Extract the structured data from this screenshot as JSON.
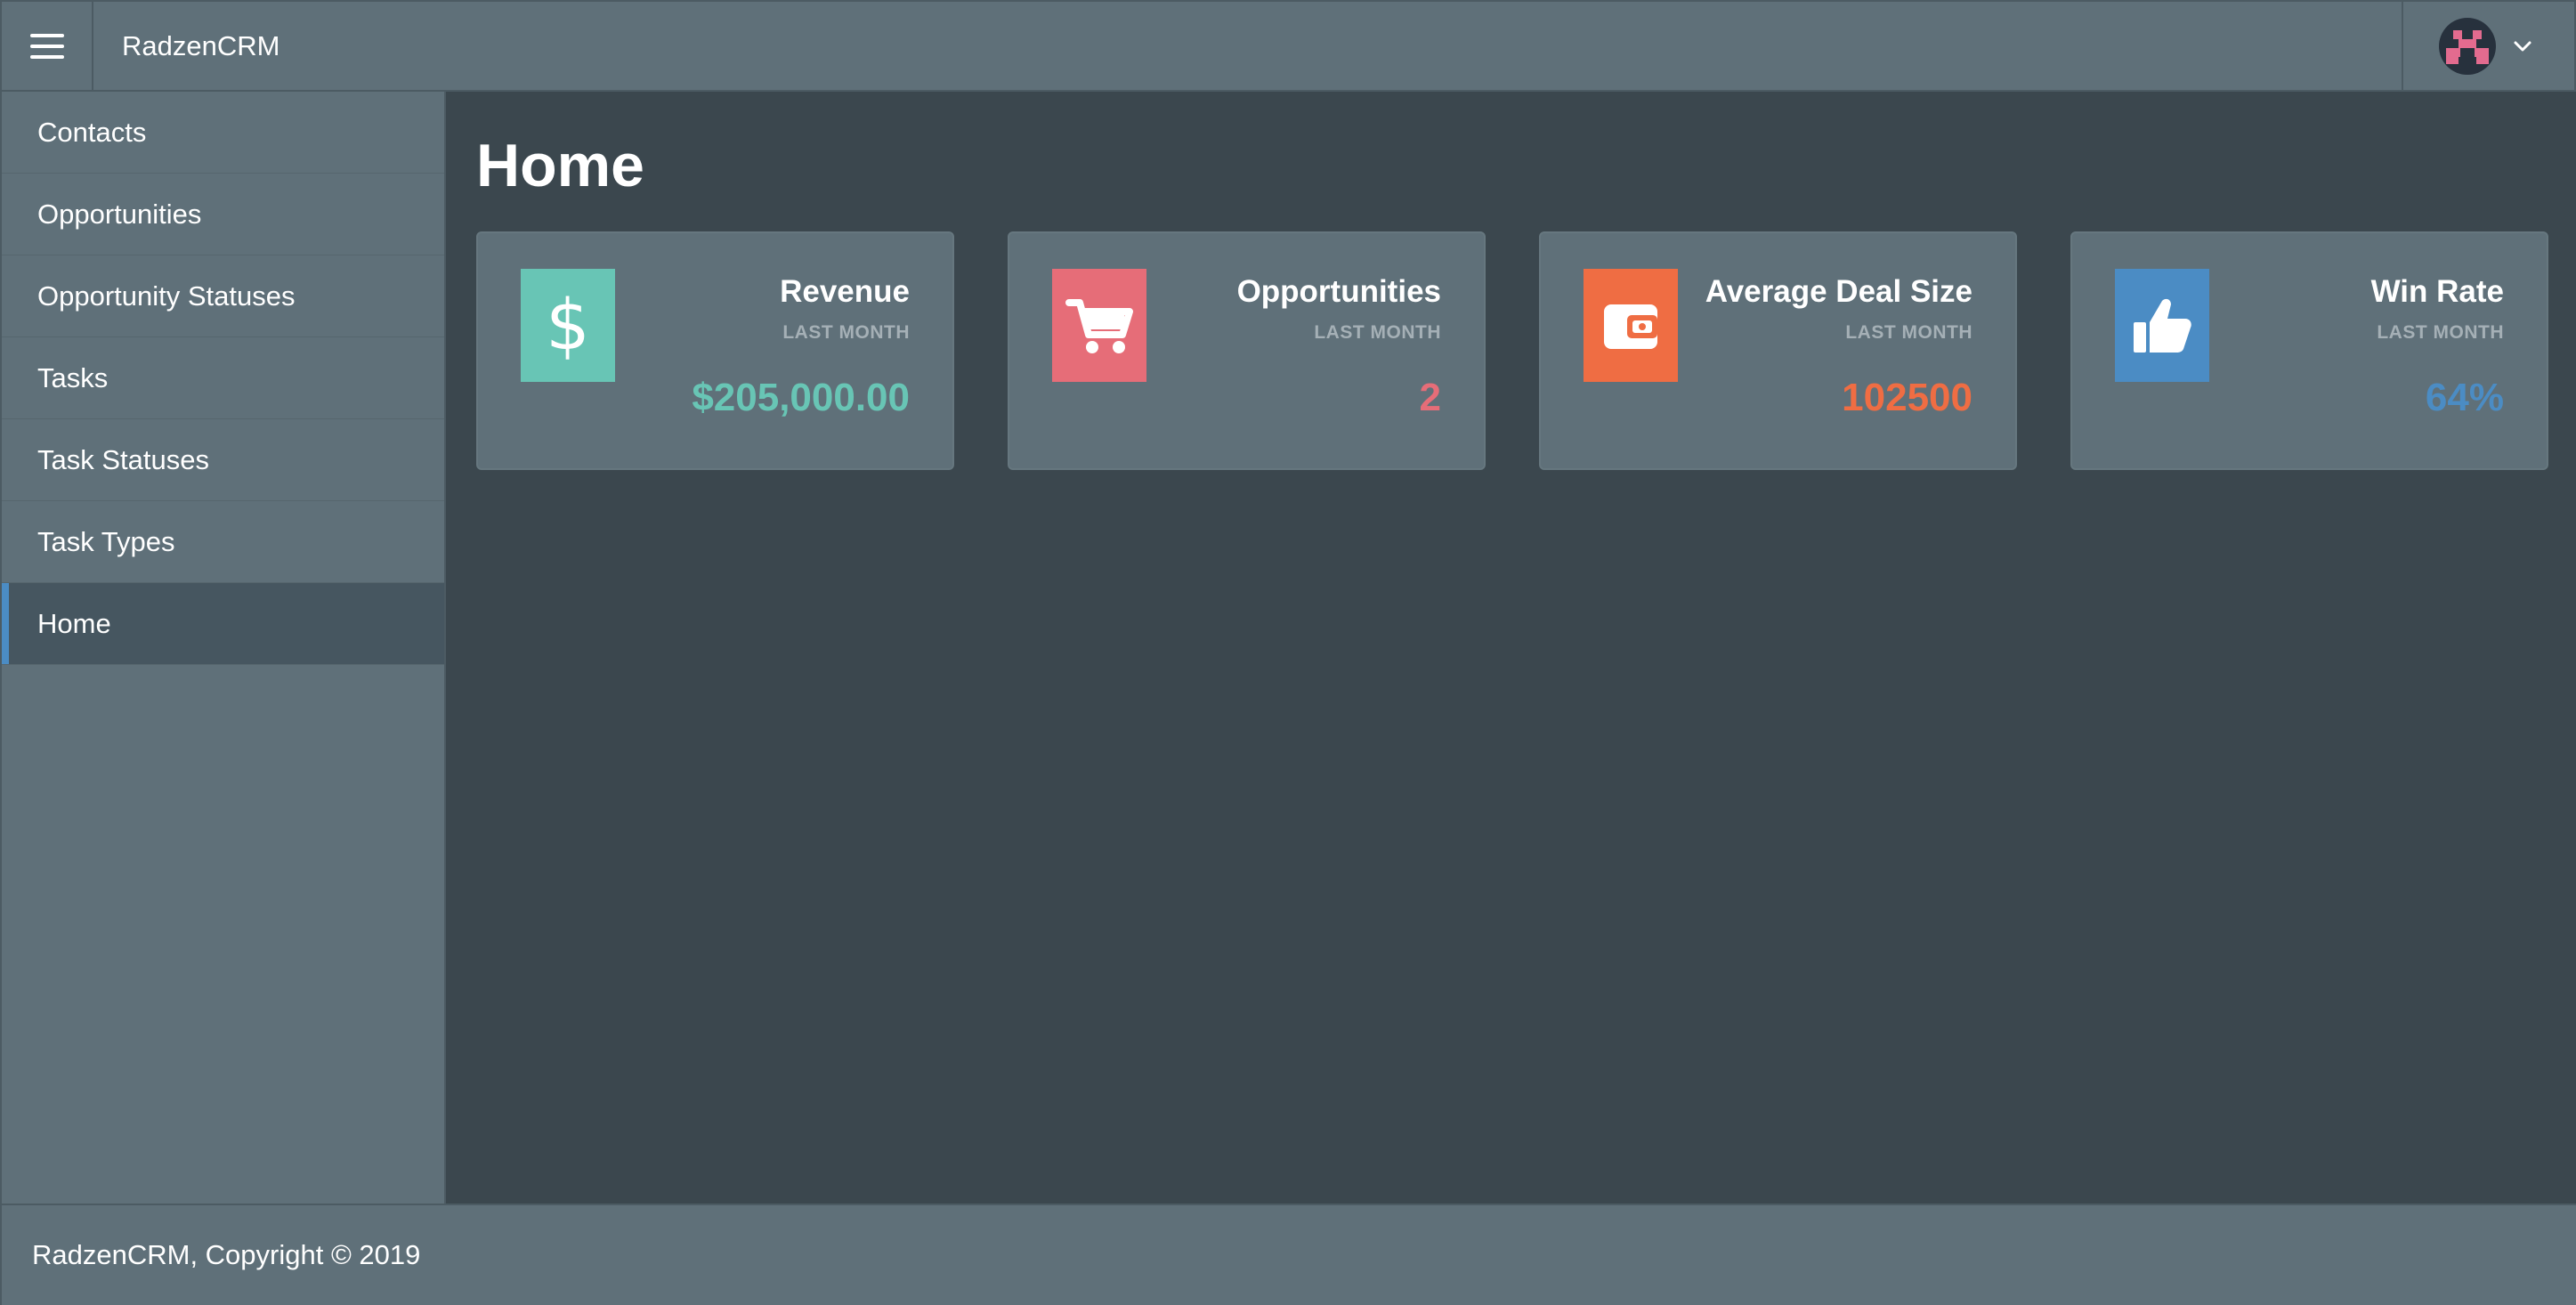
{
  "header": {
    "app_title": "RadzenCRM",
    "menu_icon": "hamburger-menu-icon",
    "profile_icon": "avatar-icon",
    "dropdown_icon": "chevron-down-icon"
  },
  "sidebar": {
    "items": [
      {
        "label": "Contacts",
        "active": false
      },
      {
        "label": "Opportunities",
        "active": false
      },
      {
        "label": "Opportunity Statuses",
        "active": false
      },
      {
        "label": "Tasks",
        "active": false
      },
      {
        "label": "Task Statuses",
        "active": false
      },
      {
        "label": "Task Types",
        "active": false
      },
      {
        "label": "Home",
        "active": true
      }
    ]
  },
  "main": {
    "title": "Home",
    "cards": [
      {
        "title": "Revenue",
        "subtitle": "LAST MONTH",
        "value": "$205,000.00",
        "icon": "dollar-icon",
        "color": "#68c5b5"
      },
      {
        "title": "Opportunities",
        "subtitle": "LAST MONTH",
        "value": "2",
        "icon": "shopping-cart-icon",
        "color": "#e66d78"
      },
      {
        "title": "Average Deal Size",
        "subtitle": "LAST MONTH",
        "value": "102500",
        "icon": "wallet-icon",
        "color": "#ef6d43"
      },
      {
        "title": "Win Rate",
        "subtitle": "LAST MONTH",
        "value": "64%",
        "icon": "thumbs-up-icon",
        "color": "#4b8cc4"
      }
    ]
  },
  "footer": {
    "text": "RadzenCRM, Copyright © 2019"
  },
  "colors": {
    "header_bg": "#5f7079",
    "content_bg": "#3b474e",
    "active_indicator": "#4b8cc4"
  }
}
